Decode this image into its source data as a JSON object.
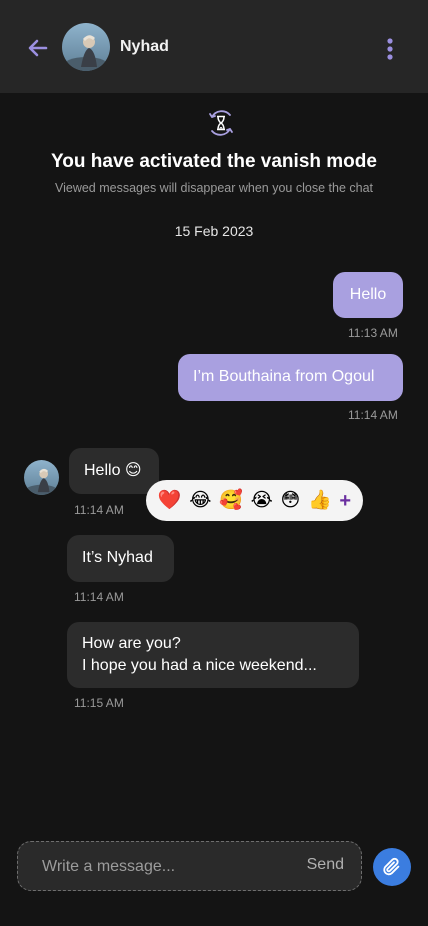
{
  "header": {
    "contact_name": "Nyhad",
    "back_icon": "arrow-left-icon",
    "more_icon": "more-vertical-icon"
  },
  "vanish": {
    "icon": "hourglass-icon",
    "title": "You have activated the vanish mode",
    "subtitle": "Viewed messages will disappear when you close the chat"
  },
  "date": "15 Feb 2023",
  "messages": [
    {
      "direction": "out",
      "text": "Hello",
      "time": "11:13 AM"
    },
    {
      "direction": "out",
      "text": "I’m Bouthaina from Ogoul",
      "time": "11:14 AM"
    },
    {
      "direction": "in",
      "text": "Hello 😊",
      "time": "11:14 AM"
    },
    {
      "direction": "in",
      "text": "It’s Nyhad",
      "time": "11:14 AM"
    },
    {
      "direction": "in",
      "lines": [
        "How are you?",
        "I hope you had a nice weekend..."
      ],
      "time": "11:15 AM"
    }
  ],
  "reactions": [
    "❤️",
    "😂",
    "🥰",
    "😭",
    "😳",
    "👍",
    "+"
  ],
  "composer": {
    "placeholder": "Write a message...",
    "send_label": "Send",
    "attach_icon": "paperclip-icon"
  },
  "colors": {
    "header_bg": "#262626",
    "page_bg": "#141414",
    "outgoing_bubble": "#a9a0e0",
    "incoming_bubble": "#2c2c2c",
    "accent": "#9b8fe0",
    "attach_button": "#3b7de0"
  }
}
